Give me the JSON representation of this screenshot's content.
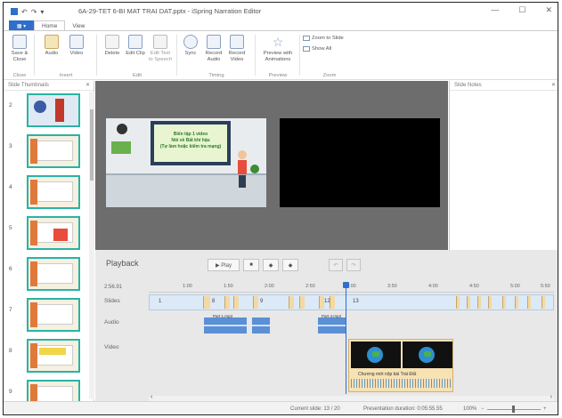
{
  "window": {
    "title": "6A-29-TET 6-BI MAT TRAI DAT.pptx - iSpring Narration Editor",
    "min": "—",
    "max": "☐",
    "close": "✕"
  },
  "tabs": [
    {
      "label": "Home"
    },
    {
      "label": "View"
    }
  ],
  "ribbon": {
    "groups": [
      {
        "label": "Close",
        "buttons": [
          {
            "label": "Save & Close"
          }
        ]
      },
      {
        "label": "Insert",
        "buttons": [
          {
            "label": "Audio"
          },
          {
            "label": "Video"
          }
        ]
      },
      {
        "label": "Edit",
        "buttons": [
          {
            "label": "Delete"
          },
          {
            "label": "Edit Clip"
          },
          {
            "label": "Edit Text to Speech"
          }
        ]
      },
      {
        "label": "Timing",
        "buttons": [
          {
            "label": "Sync"
          },
          {
            "label": "Record Audio"
          },
          {
            "label": "Record Video"
          }
        ]
      },
      {
        "label": "Preview",
        "buttons": [
          {
            "label": "Preview with Animations"
          }
        ]
      },
      {
        "label": "Zoom",
        "buttons": [
          {
            "label": "Zoom to Slide"
          },
          {
            "label": "Show All"
          }
        ]
      }
    ]
  },
  "thumbnails": {
    "title": "Slide Thumbnails",
    "close": "✕",
    "items": [
      {
        "num": "2"
      },
      {
        "num": "3"
      },
      {
        "num": "4"
      },
      {
        "num": "5"
      },
      {
        "num": "6"
      },
      {
        "num": "7"
      },
      {
        "num": "8"
      },
      {
        "num": "9"
      }
    ]
  },
  "slide": {
    "line1": "Biến tập 1 video",
    "line2": "Nói về Bất khí hậu",
    "line3": "(Tự làm hoặc kiểm tra mạng)"
  },
  "notes": {
    "title": "Slide Notes",
    "close": "✕"
  },
  "playback": {
    "title": "Playback",
    "play": "▶ Play",
    "stop": "■",
    "prev": "◆",
    "next": "◆",
    "undo": "↶",
    "redo": "↷"
  },
  "timeline": {
    "current_time": "2:56.91",
    "ticks": [
      "1:00",
      "1:50",
      "2:00",
      "2:50",
      "3:00",
      "3:50",
      "4:00",
      "4:50",
      "5:00",
      "5:50"
    ],
    "rows": {
      "slides": "Slides",
      "audio": "Audio",
      "video": "Video"
    },
    "slide_numbers": [
      "1",
      "8",
      "9",
      "12",
      "13"
    ],
    "audio_labels": [
      "Part 1.mp3",
      "",
      "Part 4.mp3"
    ],
    "video_caption": "Chương mới nộp bài Trái Đất",
    "scroll_left": "‹",
    "scroll_right": "›"
  },
  "status": {
    "current_slide": "Current slide: 13 / 20",
    "duration": "Presentation duration: 0:05:55.55",
    "zoom": "100%",
    "zoom_minus": "−",
    "zoom_plus": "+"
  },
  "colors": {
    "accent": "#2d6fcb",
    "thumb_border": "#2ab3a5",
    "audio": "#5b8fd6",
    "slide_segment": "#f3d9a4"
  }
}
